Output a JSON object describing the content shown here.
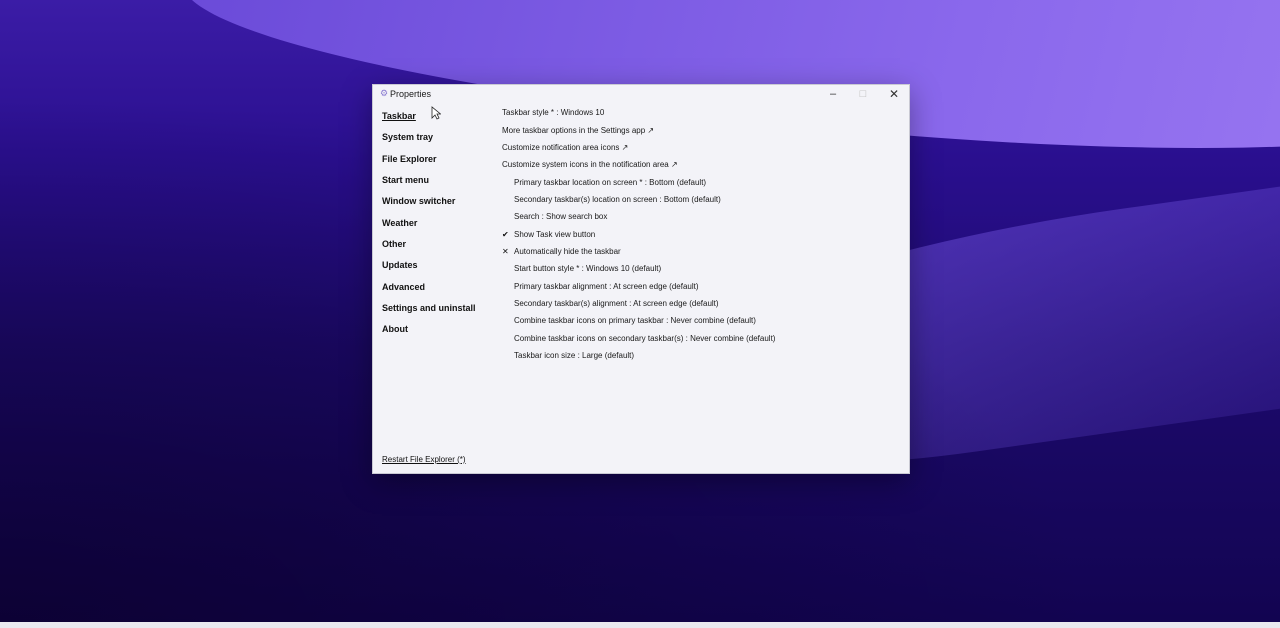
{
  "window": {
    "title": "Properties",
    "icon": "app-icon"
  },
  "controls": {
    "minimize": "–",
    "maximize": "□",
    "close": "✕"
  },
  "sidebar": {
    "items": [
      {
        "label": "Taskbar",
        "active": true
      },
      {
        "label": "System tray"
      },
      {
        "label": "File Explorer"
      },
      {
        "label": "Start menu"
      },
      {
        "label": "Window switcher"
      },
      {
        "label": "Weather"
      },
      {
        "label": "Other"
      },
      {
        "label": "Updates"
      },
      {
        "label": "Advanced"
      },
      {
        "label": "Settings and uninstall"
      },
      {
        "label": "About"
      }
    ],
    "restart_link": "Restart File Explorer (*)"
  },
  "settings": [
    {
      "label": "Taskbar style * : Windows 10",
      "indent": false
    },
    {
      "label": "More taskbar options in the Settings app ↗",
      "indent": false
    },
    {
      "label": "Customize notification area icons ↗",
      "indent": false
    },
    {
      "label": "Customize system icons in the notification area ↗",
      "indent": false
    },
    {
      "label": "Primary taskbar location on screen * : Bottom (default)",
      "indent": true
    },
    {
      "label": "Secondary taskbar(s) location on screen : Bottom (default)",
      "indent": true
    },
    {
      "label": "Search : Show search box",
      "indent": true
    },
    {
      "label": "Show Task view button",
      "indent": true,
      "mark": "✔"
    },
    {
      "label": "Automatically hide the taskbar",
      "indent": true,
      "mark": "✕"
    },
    {
      "label": "Start button style * : Windows 10 (default)",
      "indent": true
    },
    {
      "label": "Primary taskbar alignment : At screen edge (default)",
      "indent": true
    },
    {
      "label": "Secondary taskbar(s) alignment : At screen edge (default)",
      "indent": true
    },
    {
      "label": "Combine taskbar icons on primary taskbar : Never combine (default)",
      "indent": true
    },
    {
      "label": "Combine taskbar icons on secondary taskbar(s) : Never combine (default)",
      "indent": true
    },
    {
      "label": "Taskbar icon size : Large (default)",
      "indent": true
    }
  ]
}
